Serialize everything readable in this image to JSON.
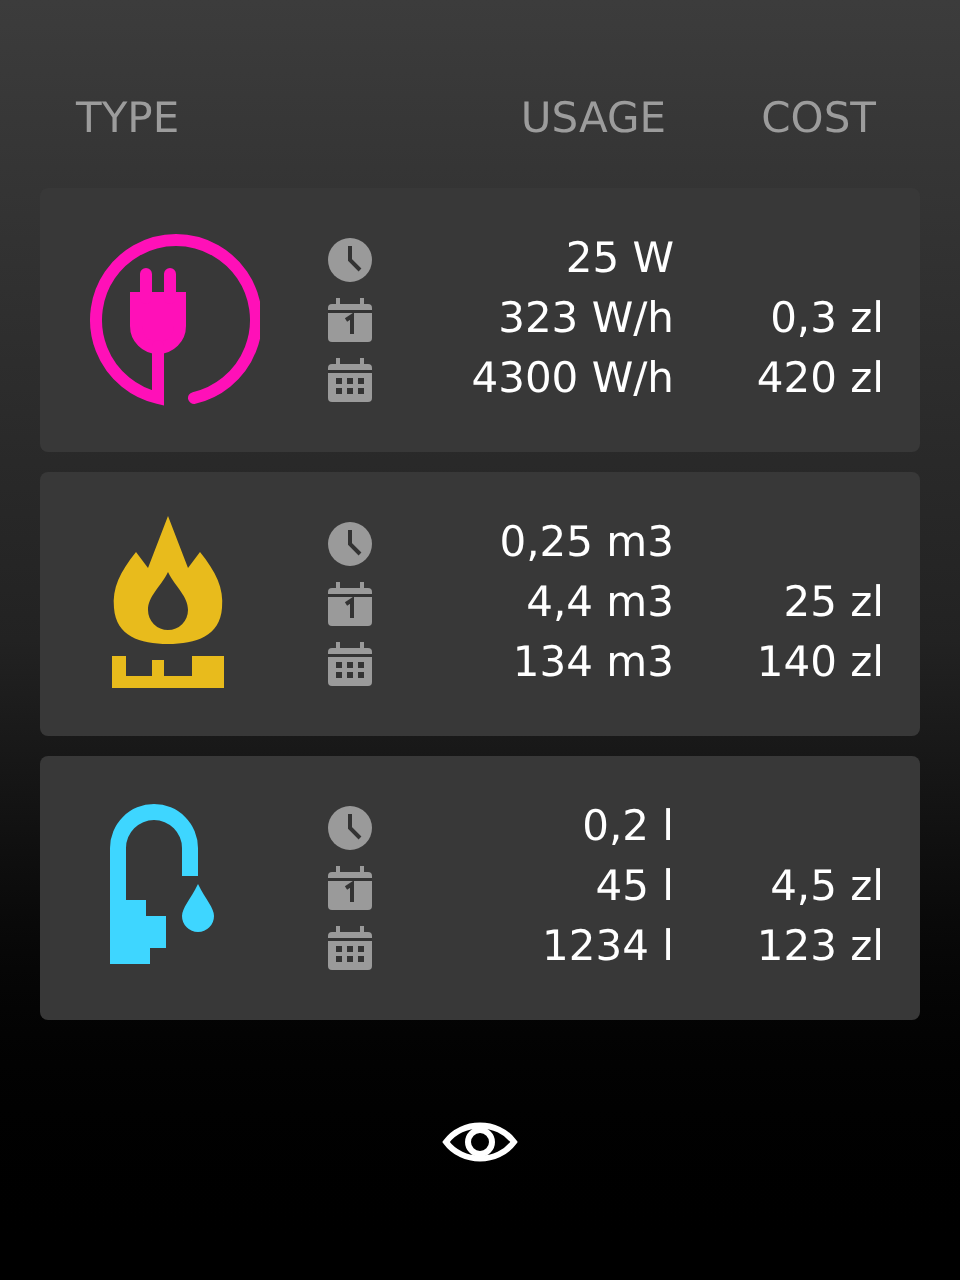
{
  "columns": [
    "TYPE",
    "USAGE",
    "COST"
  ],
  "meters": [
    {
      "kind": "electricity",
      "color": "#ff10b8",
      "rows": [
        {
          "kind": "now",
          "usage": "25 W"
        },
        {
          "kind": "day",
          "usage": "323 W/h",
          "cost": "0,3 zl"
        },
        {
          "kind": "month",
          "usage": "4300 W/h",
          "cost": "420 zl"
        }
      ]
    },
    {
      "kind": "gas",
      "color": "#e8bb1c",
      "rows": [
        {
          "kind": "now",
          "usage": "0,25 m3"
        },
        {
          "kind": "day",
          "usage": "4,4 m3",
          "cost": "25 zl"
        },
        {
          "kind": "month",
          "usage": "134 m3",
          "cost": "140 zl"
        }
      ]
    },
    {
      "kind": "water",
      "color": "#3ed6ff",
      "rows": [
        {
          "kind": "now",
          "usage": "0,2 l"
        },
        {
          "kind": "day",
          "usage": "45 l",
          "cost": "4,5 zl"
        },
        {
          "kind": "month",
          "usage": "1234 l",
          "cost": "123 zl"
        }
      ]
    }
  ]
}
